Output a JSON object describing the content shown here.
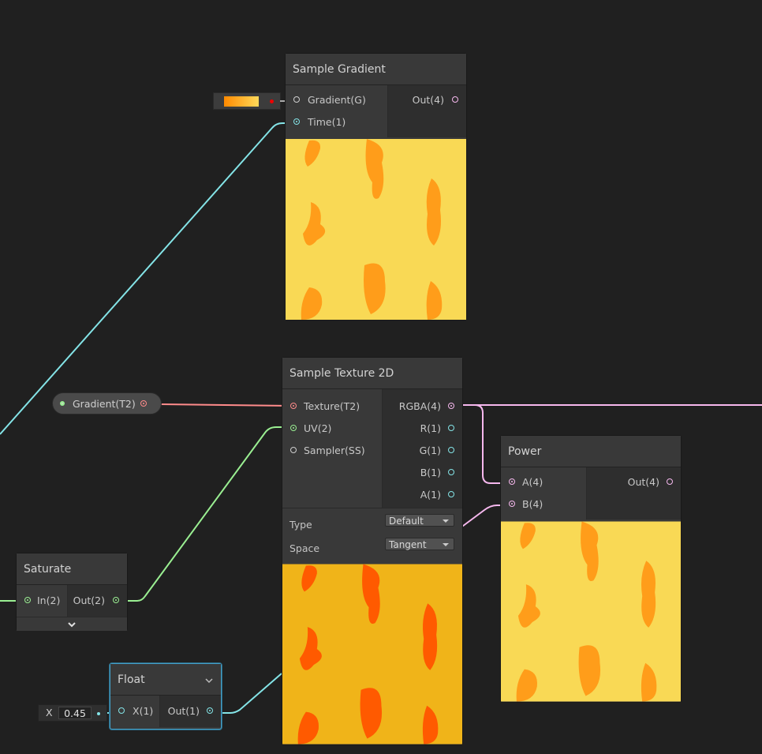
{
  "nodes": {
    "sample_gradient": {
      "title": "Sample Gradient",
      "inputs": [
        "Gradient(G)",
        "Time(1)"
      ],
      "outputs": [
        "Out(4)"
      ]
    },
    "sample_texture": {
      "title": "Sample Texture 2D",
      "inputs": [
        "Texture(T2)",
        "UV(2)",
        "Sampler(SS)"
      ],
      "outputs": [
        "RGBA(4)",
        "R(1)",
        "G(1)",
        "B(1)",
        "A(1)"
      ],
      "type_label": "Type",
      "type_value": "Default",
      "space_label": "Space",
      "space_value": "Tangent"
    },
    "power": {
      "title": "Power",
      "inputs": [
        "A(4)",
        "B(4)"
      ],
      "outputs": [
        "Out(4)"
      ]
    },
    "saturate": {
      "title": "Saturate",
      "inputs": [
        "In(2)"
      ],
      "outputs": [
        "Out(2)"
      ]
    },
    "float": {
      "title": "Float",
      "inputs": [
        "X(1)"
      ],
      "outputs": [
        "Out(1)"
      ],
      "x_label": "X",
      "x_value": "0.45"
    }
  },
  "property_pill": {
    "label": "Gradient(T2)"
  },
  "colors": {
    "background": "#202020",
    "wire_vector1": "#84e4e7",
    "wire_vector2": "#9aef92",
    "wire_vector4": "#f6b8ee",
    "wire_texture": "#ff8b8b",
    "gradient_start": "#ff8a00",
    "gradient_end": "#ffd95a",
    "preview_light": "#f9d955",
    "preview_light_blob": "#ff9d1a",
    "preview_dark": "#f0b419",
    "preview_dark_blob": "#ff5a00"
  }
}
